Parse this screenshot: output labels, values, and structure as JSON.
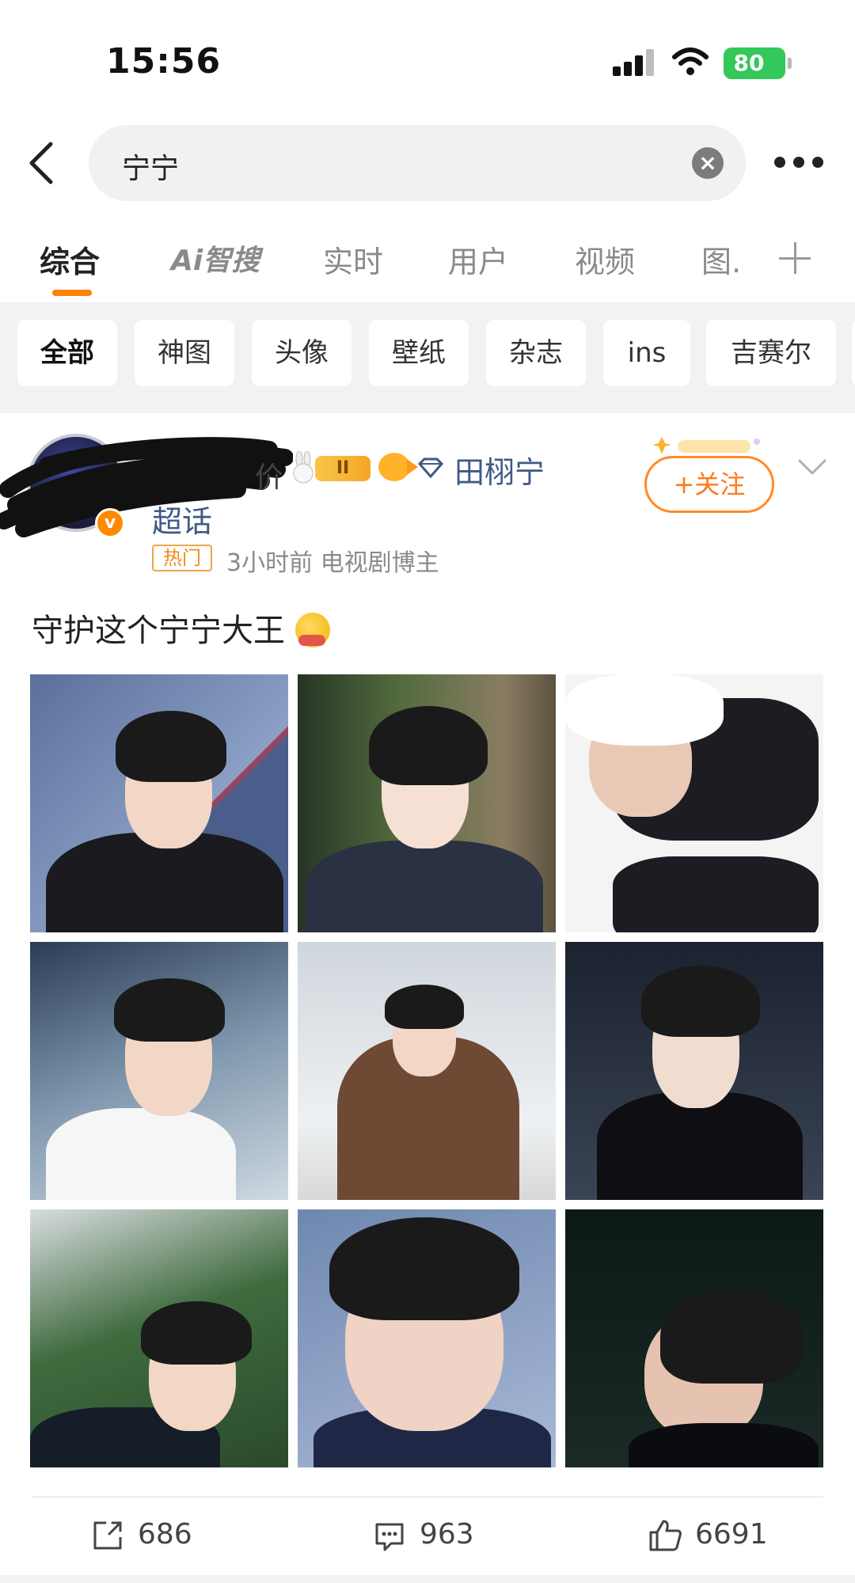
{
  "status_bar": {
    "time": "15:56",
    "battery": "80"
  },
  "search": {
    "query": "宁宁"
  },
  "tabs": [
    {
      "label": "综合",
      "active": true
    },
    {
      "label": "Ai智搜"
    },
    {
      "label": "实时"
    },
    {
      "label": "用户"
    },
    {
      "label": "视频"
    },
    {
      "label": "图."
    }
  ],
  "filters": [
    {
      "label": "全部",
      "active": true
    },
    {
      "label": "神图"
    },
    {
      "label": "头像"
    },
    {
      "label": "壁纸"
    },
    {
      "label": "杂志"
    },
    {
      "label": "ins"
    },
    {
      "label": "吉赛尔"
    }
  ],
  "post": {
    "author_fragment": "价",
    "level_badge": "II",
    "supertopic": "田栩宁",
    "supertopic_suffix": "超话",
    "hot_label": "热门",
    "meta": "3小时前  电视剧博主",
    "follow_label": "+关注",
    "text": "守护这个宁宁大王",
    "images": [
      {
        "icon": "photo-man-black-suit-blue-wall"
      },
      {
        "icon": "photo-denim-jacket-forest"
      },
      {
        "icon": "photo-black-white-glove-pose"
      },
      {
        "icon": "photo-white-shirt-glass-building"
      },
      {
        "icon": "photo-brown-jacket-sitting"
      },
      {
        "icon": "photo-black-shirt-night"
      },
      {
        "icon": "photo-green-trees-portrait"
      },
      {
        "icon": "photo-closeup-messy-hair"
      },
      {
        "icon": "photo-dark-injured-face"
      }
    ]
  },
  "actions": {
    "shares": "686",
    "comments": "963",
    "likes": "6691"
  },
  "colors": {
    "accent": "#ff8200",
    "link": "#3f5a86",
    "battery": "#34c759",
    "filter_bg": "#f2f2f2"
  }
}
